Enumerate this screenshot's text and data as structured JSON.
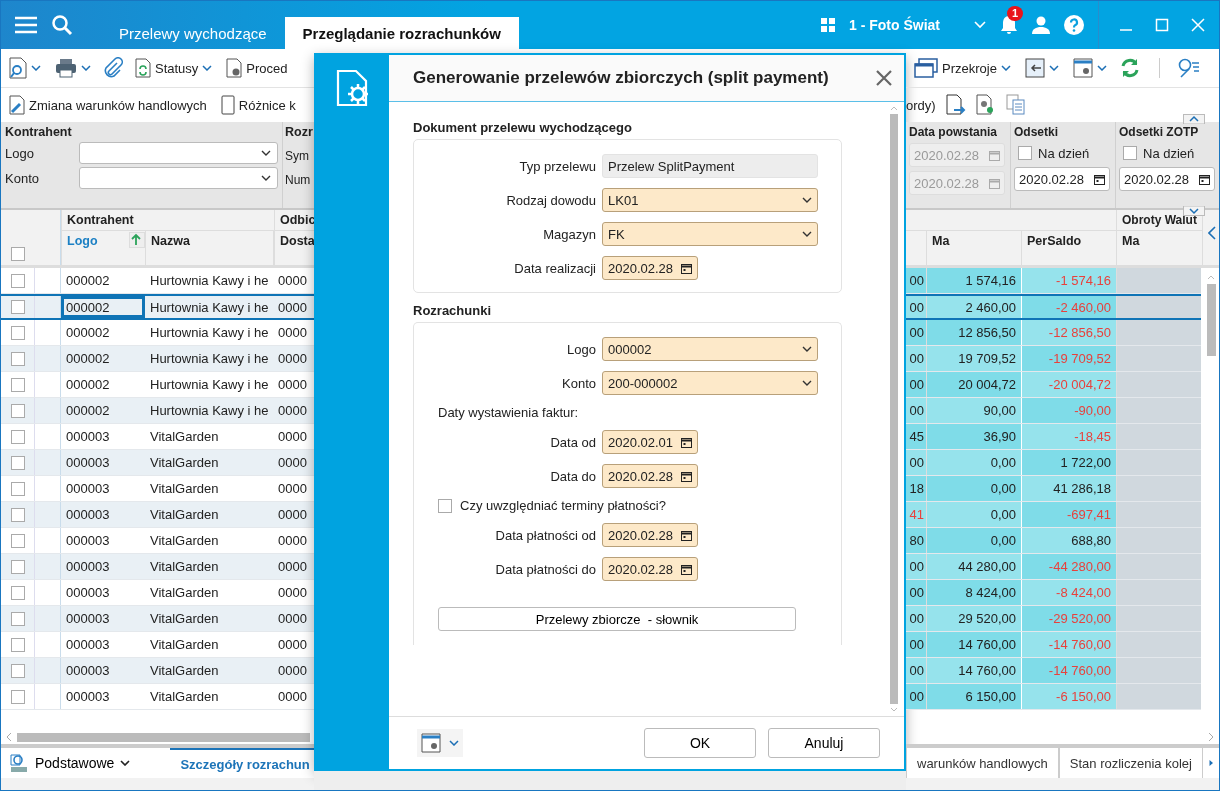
{
  "topbar": {
    "tabs": [
      {
        "label": "Przelewy wychodzące",
        "selected": false
      },
      {
        "label": "Przeglądanie rozrachunków",
        "selected": true
      }
    ],
    "company": "1 - Foto Świat",
    "notifications": "1"
  },
  "left_toolbar": {
    "buttons": [
      "Statusy",
      "Proced"
    ],
    "actions": [
      "Zmiana warunków handlowych",
      "Różnice k"
    ]
  },
  "left_filter": {
    "group": "Kontrahent",
    "fields": [
      "Logo",
      "Konto"
    ],
    "next_group": "Rozr",
    "next_labels": [
      "Sym",
      "Num"
    ]
  },
  "left_table": {
    "select_all_checked": false,
    "group": "Kontrahent",
    "columns": [
      {
        "label": "Logo",
        "sorted": true
      },
      {
        "label": "Nazwa",
        "sorted": false
      }
    ],
    "next_group": "Odbic",
    "next_column": "Dosta"
  },
  "right_toolbar": {
    "button": "Przekroje",
    "action_text": "ordy)"
  },
  "right_filter": {
    "data_powstania": {
      "label": "Data powstania",
      "dates": [
        "2020.02.28",
        "2020.02.28"
      ]
    },
    "odsetki": [
      {
        "label": "Odsetki",
        "checkbox_label": "Na dzień",
        "checked": false,
        "date": "2020.02.28"
      },
      {
        "label": "Odsetki ZOTP",
        "checkbox_label": "Na dzień",
        "checked": false,
        "date": "2020.02.28"
      }
    ]
  },
  "right_table": {
    "group": "Obroty Walut",
    "columns": [
      "Ma",
      "PerSaldo",
      "Ma"
    ]
  },
  "rows": [
    {
      "checked": false,
      "selected": false,
      "logo": "000002",
      "nazwa": "Hurtownia Kawy i he",
      "col_3": "0000",
      "col_4": "00",
      "col_4_negative": false,
      "ma": "1 574,16",
      "persaldo": "-1 574,16",
      "persaldo_negative": true
    },
    {
      "checked": false,
      "selected": true,
      "logo": "000002",
      "nazwa": "Hurtownia Kawy i he",
      "col_3": "0000",
      "col_4": "00",
      "col_4_negative": false,
      "ma": "2 460,00",
      "persaldo": "-2 460,00",
      "persaldo_negative": true
    },
    {
      "checked": false,
      "selected": false,
      "logo": "000002",
      "nazwa": "Hurtownia Kawy i he",
      "col_3": "0000",
      "col_4": "00",
      "col_4_negative": false,
      "ma": "12 856,50",
      "persaldo": "-12 856,50",
      "persaldo_negative": true
    },
    {
      "checked": false,
      "selected": false,
      "logo": "000002",
      "nazwa": "Hurtownia Kawy i he",
      "col_3": "0000",
      "col_4": "00",
      "col_4_negative": false,
      "ma": "19 709,52",
      "persaldo": "-19 709,52",
      "persaldo_negative": true
    },
    {
      "checked": false,
      "selected": false,
      "logo": "000002",
      "nazwa": "Hurtownia Kawy i he",
      "col_3": "0000",
      "col_4": "00",
      "col_4_negative": false,
      "ma": "20 004,72",
      "persaldo": "-20 004,72",
      "persaldo_negative": true
    },
    {
      "checked": false,
      "selected": false,
      "logo": "000002",
      "nazwa": "Hurtownia Kawy i he",
      "col_3": "0000",
      "col_4": "00",
      "col_4_negative": false,
      "ma": "90,00",
      "persaldo": "-90,00",
      "persaldo_negative": true
    },
    {
      "checked": false,
      "selected": false,
      "logo": "000003",
      "nazwa": "VitalGarden",
      "col_3": "0000",
      "col_4": "45",
      "col_4_negative": false,
      "ma": "36,90",
      "persaldo": "-18,45",
      "persaldo_negative": true
    },
    {
      "checked": false,
      "selected": false,
      "logo": "000003",
      "nazwa": "VitalGarden",
      "col_3": "0000",
      "col_4": "00",
      "col_4_negative": false,
      "ma": "0,00",
      "persaldo": "1 722,00",
      "persaldo_negative": false
    },
    {
      "checked": false,
      "selected": false,
      "logo": "000003",
      "nazwa": "VitalGarden",
      "col_3": "0000",
      "col_4": "18",
      "col_4_negative": false,
      "ma": "0,00",
      "persaldo": "41 286,18",
      "persaldo_negative": false
    },
    {
      "checked": false,
      "selected": false,
      "logo": "000003",
      "nazwa": "VitalGarden",
      "col_3": "0000",
      "col_4": "41",
      "col_4_negative": true,
      "ma": "0,00",
      "persaldo": "-697,41",
      "persaldo_negative": true
    },
    {
      "checked": false,
      "selected": false,
      "logo": "000003",
      "nazwa": "VitalGarden",
      "col_3": "0000",
      "col_4": "80",
      "col_4_negative": false,
      "ma": "0,00",
      "persaldo": "688,80",
      "persaldo_negative": false
    },
    {
      "checked": false,
      "selected": false,
      "logo": "000003",
      "nazwa": "VitalGarden",
      "col_3": "0000",
      "col_4": "00",
      "col_4_negative": false,
      "ma": "44 280,00",
      "persaldo": "-44 280,00",
      "persaldo_negative": true
    },
    {
      "checked": false,
      "selected": false,
      "logo": "000003",
      "nazwa": "VitalGarden",
      "col_3": "0000",
      "col_4": "00",
      "col_4_negative": false,
      "ma": "8 424,00",
      "persaldo": "-8 424,00",
      "persaldo_negative": true
    },
    {
      "checked": false,
      "selected": false,
      "logo": "000003",
      "nazwa": "VitalGarden",
      "col_3": "0000",
      "col_4": "00",
      "col_4_negative": false,
      "ma": "29 520,00",
      "persaldo": "-29 520,00",
      "persaldo_negative": true
    },
    {
      "checked": false,
      "selected": false,
      "logo": "000003",
      "nazwa": "VitalGarden",
      "col_3": "0000",
      "col_4": "00",
      "col_4_negative": false,
      "ma": "14 760,00",
      "persaldo": "-14 760,00",
      "persaldo_negative": true
    },
    {
      "checked": false,
      "selected": false,
      "logo": "000003",
      "nazwa": "VitalGarden",
      "col_3": "0000",
      "col_4": "00",
      "col_4_negative": false,
      "ma": "14 760,00",
      "persaldo": "-14 760,00",
      "persaldo_negative": true
    },
    {
      "checked": false,
      "selected": false,
      "logo": "000003",
      "nazwa": "VitalGarden",
      "col_3": "0000",
      "col_4": "00",
      "col_4_negative": false,
      "ma": "6 150,00",
      "persaldo": "-6 150,00",
      "persaldo_negative": true
    }
  ],
  "dialog": {
    "title": "Generowanie przelewów zbiorczych (split payment)",
    "sections": [
      {
        "title": "Dokument przelewu wychodzącego",
        "fields": [
          {
            "kind": "text",
            "label": "Typ przelewu",
            "value": "Przelew SplitPayment"
          },
          {
            "kind": "select",
            "label": "Rodzaj dowodu",
            "value": "LK01"
          },
          {
            "kind": "select",
            "label": "Magazyn",
            "value": "FK"
          },
          {
            "kind": "date",
            "label": "Data realizacji",
            "value": "2020.02.28"
          }
        ]
      },
      {
        "title": "Rozrachunki",
        "fields": [
          {
            "kind": "select",
            "label": "Logo",
            "value": "000002"
          },
          {
            "kind": "select",
            "label": "Konto",
            "value": "200-000002"
          },
          {
            "kind": "note",
            "label": "Daty wystawienia faktur:"
          },
          {
            "kind": "date",
            "label": "Data od",
            "value": "2020.02.01"
          },
          {
            "kind": "date",
            "label": "Data do",
            "value": "2020.02.28"
          },
          {
            "kind": "checkbox",
            "label": "Czy uwzględniać terminy płatności?",
            "checked": false
          },
          {
            "kind": "date",
            "label": "Data płatności od",
            "value": "2020.02.28"
          },
          {
            "kind": "date",
            "label": "Data płatności do",
            "value": "2020.02.28"
          },
          {
            "kind": "button",
            "label": "Przelewy zbiorcze  - słownik"
          }
        ]
      }
    ],
    "buttons": [
      "OK",
      "Anuluj"
    ]
  },
  "bottom": {
    "view": "Podstawowe",
    "tabs": [
      {
        "label": "Szczegóły rozrachun",
        "selected": true
      },
      {
        "label": "warunków handlowych",
        "selected": false
      },
      {
        "label": "Stan rozliczenia kolej",
        "selected": false
      }
    ]
  }
}
